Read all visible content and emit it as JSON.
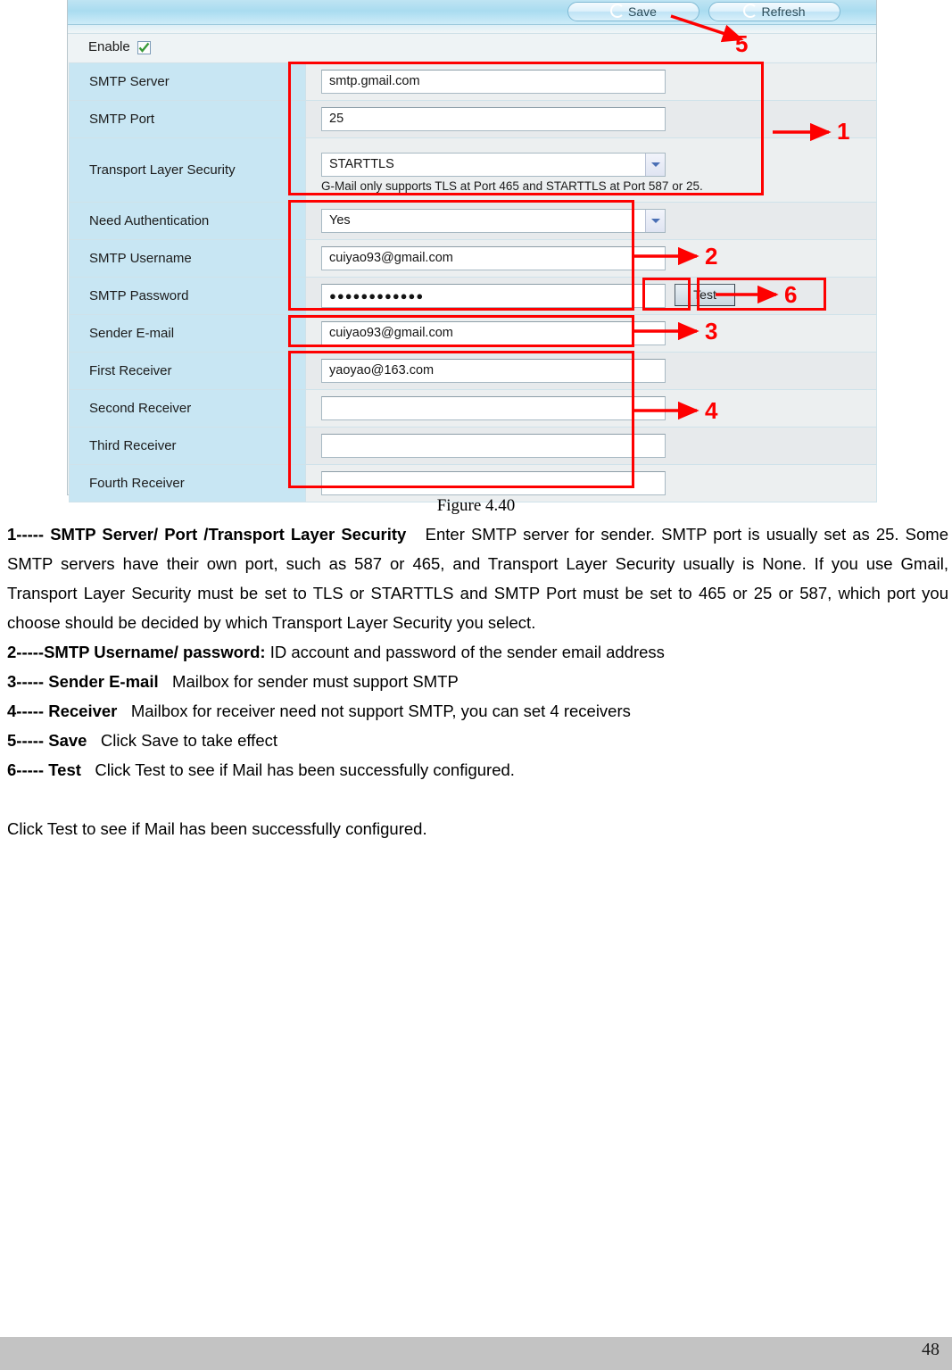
{
  "figure": {
    "caption": "Figure 4.40",
    "toolbar": {
      "save_label": "Save",
      "refresh_label": "Refresh"
    },
    "enable": {
      "label": "Enable",
      "checked": "true"
    },
    "rows": [
      {
        "label": "SMTP Server",
        "value": "smtp.gmail.com",
        "type": "text"
      },
      {
        "label": "SMTP Port",
        "value": "25",
        "type": "text"
      },
      {
        "label": "Transport Layer Security",
        "value": "STARTTLS",
        "type": "select",
        "hint": "G-Mail only supports TLS at Port 465 and STARTTLS at Port 587 or 25."
      },
      {
        "label": "Need Authentication",
        "value": "Yes",
        "type": "select"
      },
      {
        "label": "SMTP Username",
        "value": "cuiyao93@gmail.com",
        "type": "text"
      },
      {
        "label": "SMTP Password",
        "value": "●●●●●●●●●●●●",
        "type": "password",
        "button": "Test"
      },
      {
        "label": "Sender E-mail",
        "value": "cuiyao93@gmail.com",
        "type": "text"
      },
      {
        "label": "First Receiver",
        "value": "yaoyao@163.com",
        "type": "text"
      },
      {
        "label": "Second Receiver",
        "value": "",
        "type": "text"
      },
      {
        "label": "Third Receiver",
        "value": "",
        "type": "text"
      },
      {
        "label": "Fourth Receiver",
        "value": "",
        "type": "text"
      }
    ],
    "annotations": {
      "accent_color": "#fe0000",
      "markers": [
        "1",
        "2",
        "3",
        "4",
        "5",
        "6"
      ]
    }
  },
  "body": {
    "item1_title": "1----- SMTP Server/ Port /Transport Layer Security",
    "item1_text": "Enter SMTP server for sender. SMTP port is usually set as 25. Some SMTP servers have their own port, such as 587 or 465, and Transport Layer Security usually is None. If you use Gmail, Transport Layer Security must be set to TLS or STARTTLS and SMTP Port must be set to 465 or 25 or 587, which port you choose should be decided by which Transport Layer Security you select.",
    "item2_title": "2-----SMTP Username/ password:",
    "item2_text": "ID account and password of the sender email address",
    "item3_title": "3----- Sender E-mail",
    "item3_text": "Mailbox for sender must support SMTP",
    "item4_title": "4----- Receiver",
    "item4_text": "Mailbox for receiver need not support SMTP, you can set 4 receivers",
    "item5_title": "5----- Save",
    "item5_text": "Click Save to take effect",
    "item6_title": "6----- Test",
    "item6_text": "Click Test to see if Mail has been successfully configured.",
    "closing": "Click Test to see if Mail has been successfully configured."
  },
  "footer": {
    "page_number": "48"
  }
}
